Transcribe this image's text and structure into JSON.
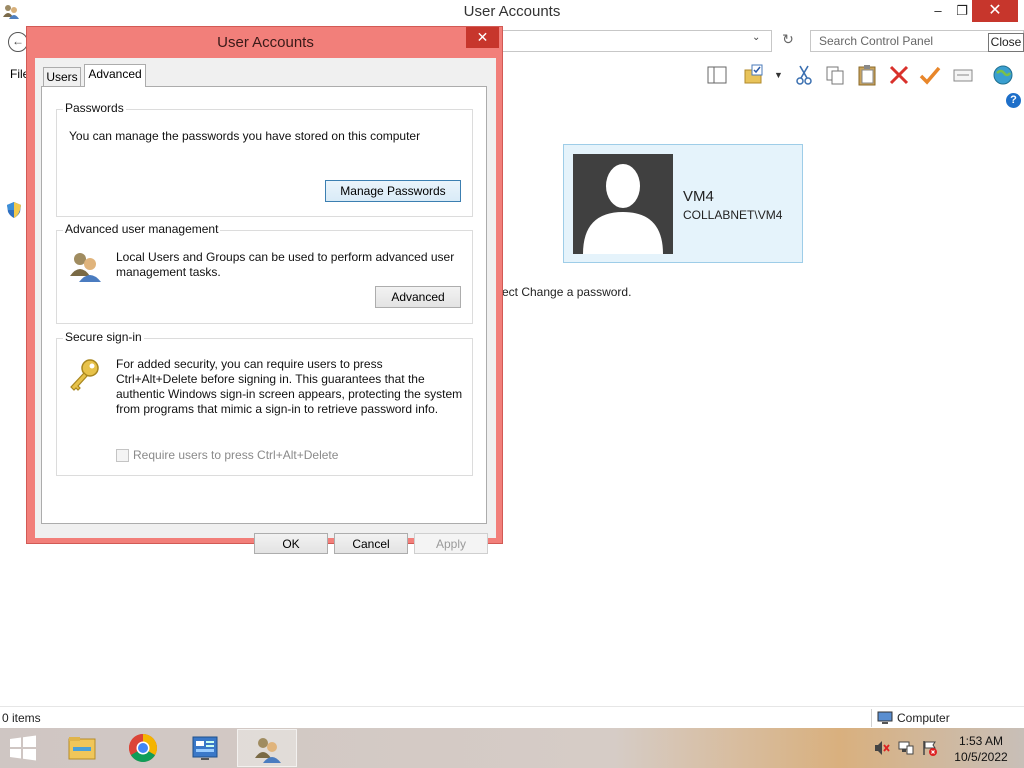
{
  "window": {
    "title": "User Accounts",
    "controls": {
      "minimize": "–",
      "maximize": "❐",
      "close": "✕"
    }
  },
  "address_bar": {
    "back_glyph": "←",
    "dropdown_glyph": "⌄",
    "refresh_glyph": "↻",
    "search_placeholder": "Search Control Panel",
    "tooltip": "Close"
  },
  "menu": {
    "file_label": "File"
  },
  "toolbar": {
    "icons": [
      "layout-icon",
      "folder-options-icon",
      "cut-icon",
      "copy-icon",
      "paste-icon",
      "delete-icon",
      "check-icon",
      "properties-icon",
      "globe-icon"
    ],
    "help_glyph": "?"
  },
  "user_tile": {
    "name": "VM4",
    "domain": "COLLABNET\\VM4"
  },
  "content": {
    "change_password_text": "ect Change a password."
  },
  "status_bar": {
    "items_count": "0 items",
    "location": "Computer"
  },
  "dialog": {
    "title": "User Accounts",
    "close_glyph": "✕",
    "tabs": [
      {
        "label": "Users",
        "active": false
      },
      {
        "label": "Advanced",
        "active": true
      }
    ],
    "passwords": {
      "heading": "Passwords",
      "description": "You can manage the passwords you have stored on this computer",
      "button": "Manage Passwords"
    },
    "advanced_user_management": {
      "heading": "Advanced user management",
      "description": "Local Users and Groups can be used to perform advanced user management tasks.",
      "button": "Advanced"
    },
    "secure_signin": {
      "heading": "Secure sign-in",
      "description": "For added security, you can require users to press Ctrl+Alt+Delete before signing in. This guarantees that the authentic Windows sign-in screen appears, protecting the system from programs that mimic a sign-in to retrieve password info.",
      "checkbox_label": "Require users to press Ctrl+Alt+Delete",
      "checkbox_checked": false,
      "checkbox_enabled": false
    },
    "buttons": {
      "ok": "OK",
      "cancel": "Cancel",
      "apply": "Apply"
    }
  },
  "taskbar": {
    "apps": [
      "file-explorer-icon",
      "chrome-icon",
      "server-manager-icon",
      "user-accounts-icon"
    ],
    "active_app": "user-accounts-icon",
    "clock": {
      "time": "1:53 AM",
      "date": "10/5/2022"
    }
  },
  "colors": {
    "dialog_frame": "#f27f7a",
    "close_button": "#c7362c",
    "user_tile_bg": "#e5f3fb",
    "help_icon": "#1e6fc9"
  }
}
